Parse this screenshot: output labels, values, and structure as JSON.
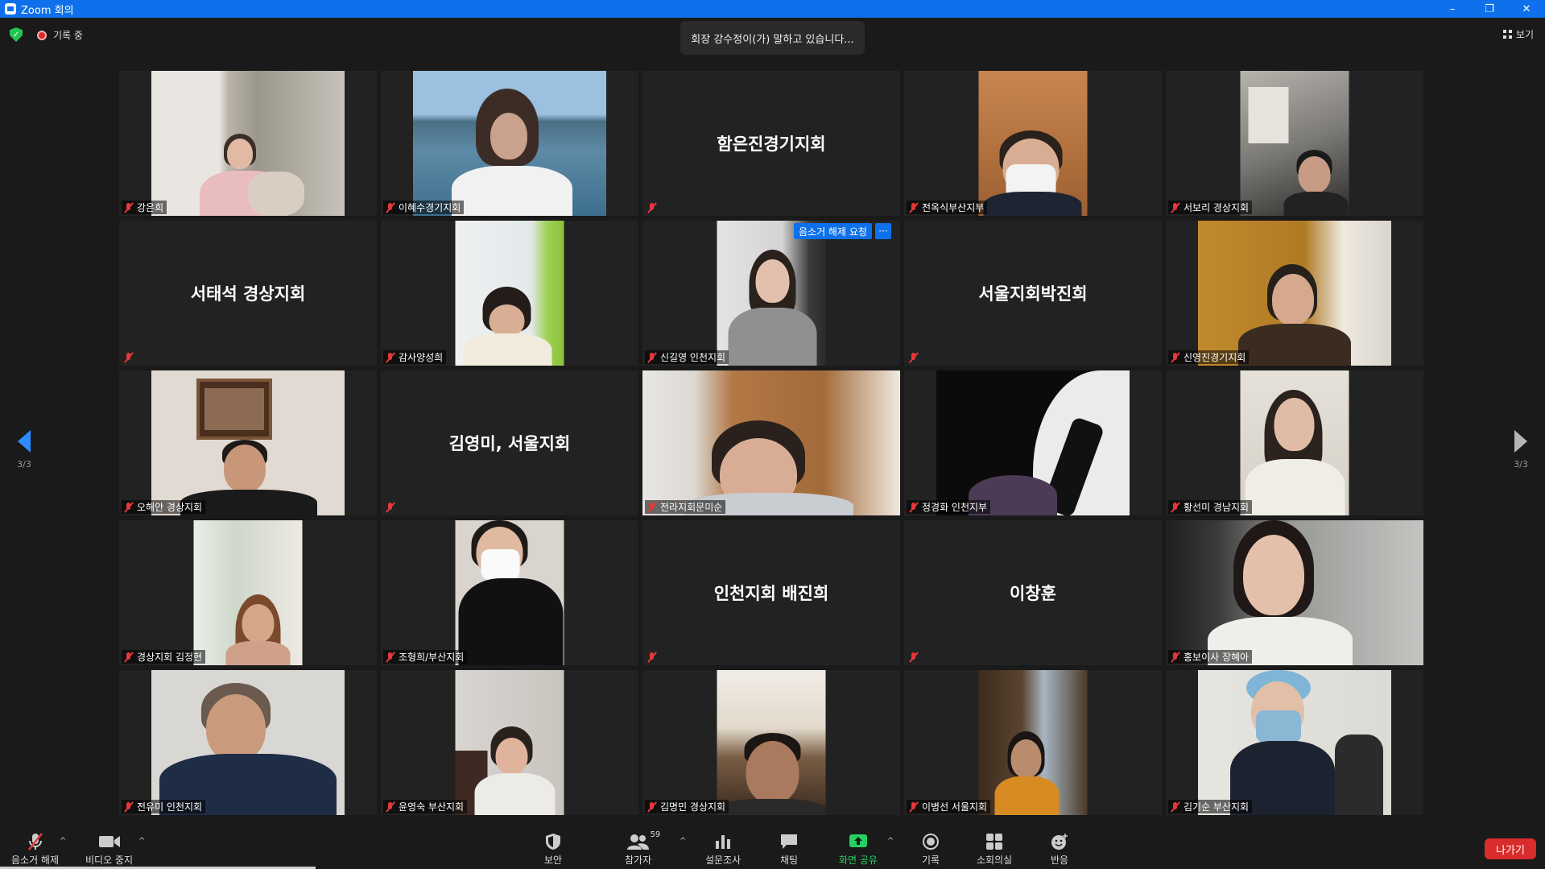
{
  "window": {
    "title": "Zoom 회의",
    "minimize": "–",
    "restore": "❐",
    "close": "✕"
  },
  "topbar": {
    "security_check": "✓",
    "recording_text": "기록 중",
    "speaking_banner": "회장 강수정이(가) 말하고 있습니다...",
    "view_label": "보기"
  },
  "pager": {
    "left_count": "3/3",
    "right_count": "3/3"
  },
  "tiles": [
    {
      "name": "강은희",
      "video": true,
      "bg": "#c9c2b8"
    },
    {
      "name": "이혜수경기지회",
      "video": true,
      "bg": "#5d87a8"
    },
    {
      "name": "",
      "display_name": "함은진경기지회",
      "video": false
    },
    {
      "name": "전옥식부산지부",
      "video": true,
      "bg": "#b77a45"
    },
    {
      "name": "서보리 경상지회",
      "video": true,
      "bg": "#8f8f8a"
    },
    {
      "name": "",
      "display_name": "서태석 경상지회",
      "video": false
    },
    {
      "name": "감사양성희",
      "video": true,
      "bg": "#dfe6e8"
    },
    {
      "name": "신길영 인천지회",
      "video": true,
      "bg": "#cfcfcf",
      "unmute_request": "음소거 해제 요청",
      "more": "···"
    },
    {
      "name": "",
      "display_name": "서울지회박진희",
      "video": false
    },
    {
      "name": "신영진경기지회",
      "video": true,
      "bg": "#b8862e"
    },
    {
      "name": "오해안 경상지회",
      "video": true,
      "bg": "#d6cdc4"
    },
    {
      "name": "",
      "display_name": "김영미, 서울지회",
      "video": false
    },
    {
      "name": "전라지회문미순",
      "video": true,
      "bg": "#b07c4a"
    },
    {
      "name": "정경화 인천지부",
      "video": true,
      "bg": "#0d0d0d"
    },
    {
      "name": "황선미 경남지회",
      "video": true,
      "bg": "#d9d4cc"
    },
    {
      "name": "경상지회 김정현",
      "video": true,
      "bg": "#d8d8d2"
    },
    {
      "name": "조형희/부산지회",
      "video": true,
      "bg": "#d7d2cc"
    },
    {
      "name": "",
      "display_name": "인천지회 배진희",
      "video": false
    },
    {
      "name": "",
      "display_name": "이창훈",
      "video": false
    },
    {
      "name": "홍보이사 장혜아",
      "video": true,
      "bg": "#8a8b88"
    },
    {
      "name": "전유미 인천지회",
      "video": true,
      "bg": "#d4d3cf"
    },
    {
      "name": "윤영숙 부산지회",
      "video": true,
      "bg": "#cfcac6"
    },
    {
      "name": "김명민 경상지회",
      "video": true,
      "bg": "#c7b9a5"
    },
    {
      "name": "이병선 서울지회",
      "video": true,
      "bg": "#5a4633"
    },
    {
      "name": "김기순 부산지회",
      "video": true,
      "bg": "#d9d6d1"
    }
  ],
  "toolbar": {
    "unmute": "음소거 해제",
    "stop_video": "비디오 중지",
    "security": "보안",
    "participants": "참가자",
    "participants_count": "59",
    "polls": "설문조사",
    "chat": "채팅",
    "share_screen": "화면 공유",
    "record": "기록",
    "breakout": "소회의실",
    "reactions": "반응",
    "leave": "나가기",
    "caret": "^"
  },
  "colors": {
    "accent": "#0e71eb",
    "leave": "#d92c2c",
    "share": "#23d160",
    "muted": "#e5383b"
  }
}
